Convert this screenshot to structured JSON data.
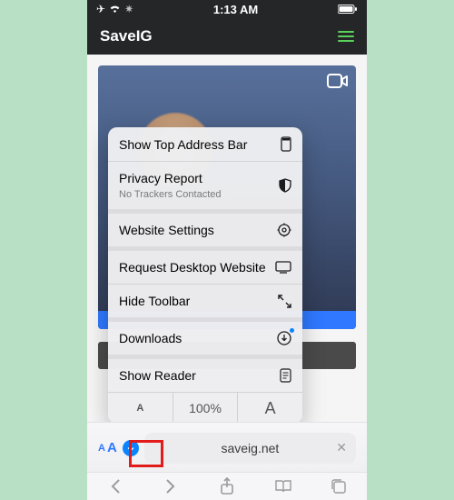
{
  "status": {
    "time": "1:13 AM"
  },
  "site": {
    "title": "SaveIG"
  },
  "menu": {
    "show_top": "Show Top Address Bar",
    "privacy": "Privacy Report",
    "privacy_sub": "No Trackers Contacted",
    "settings": "Website Settings",
    "desktop": "Request Desktop Website",
    "hide_tb": "Hide Toolbar",
    "downloads": "Downloads",
    "reader": "Show Reader",
    "zoom": "100%",
    "small_a": "A",
    "big_a": "A"
  },
  "url": {
    "aa_small": "A",
    "aa_big": "A",
    "host": "saveig.net"
  }
}
